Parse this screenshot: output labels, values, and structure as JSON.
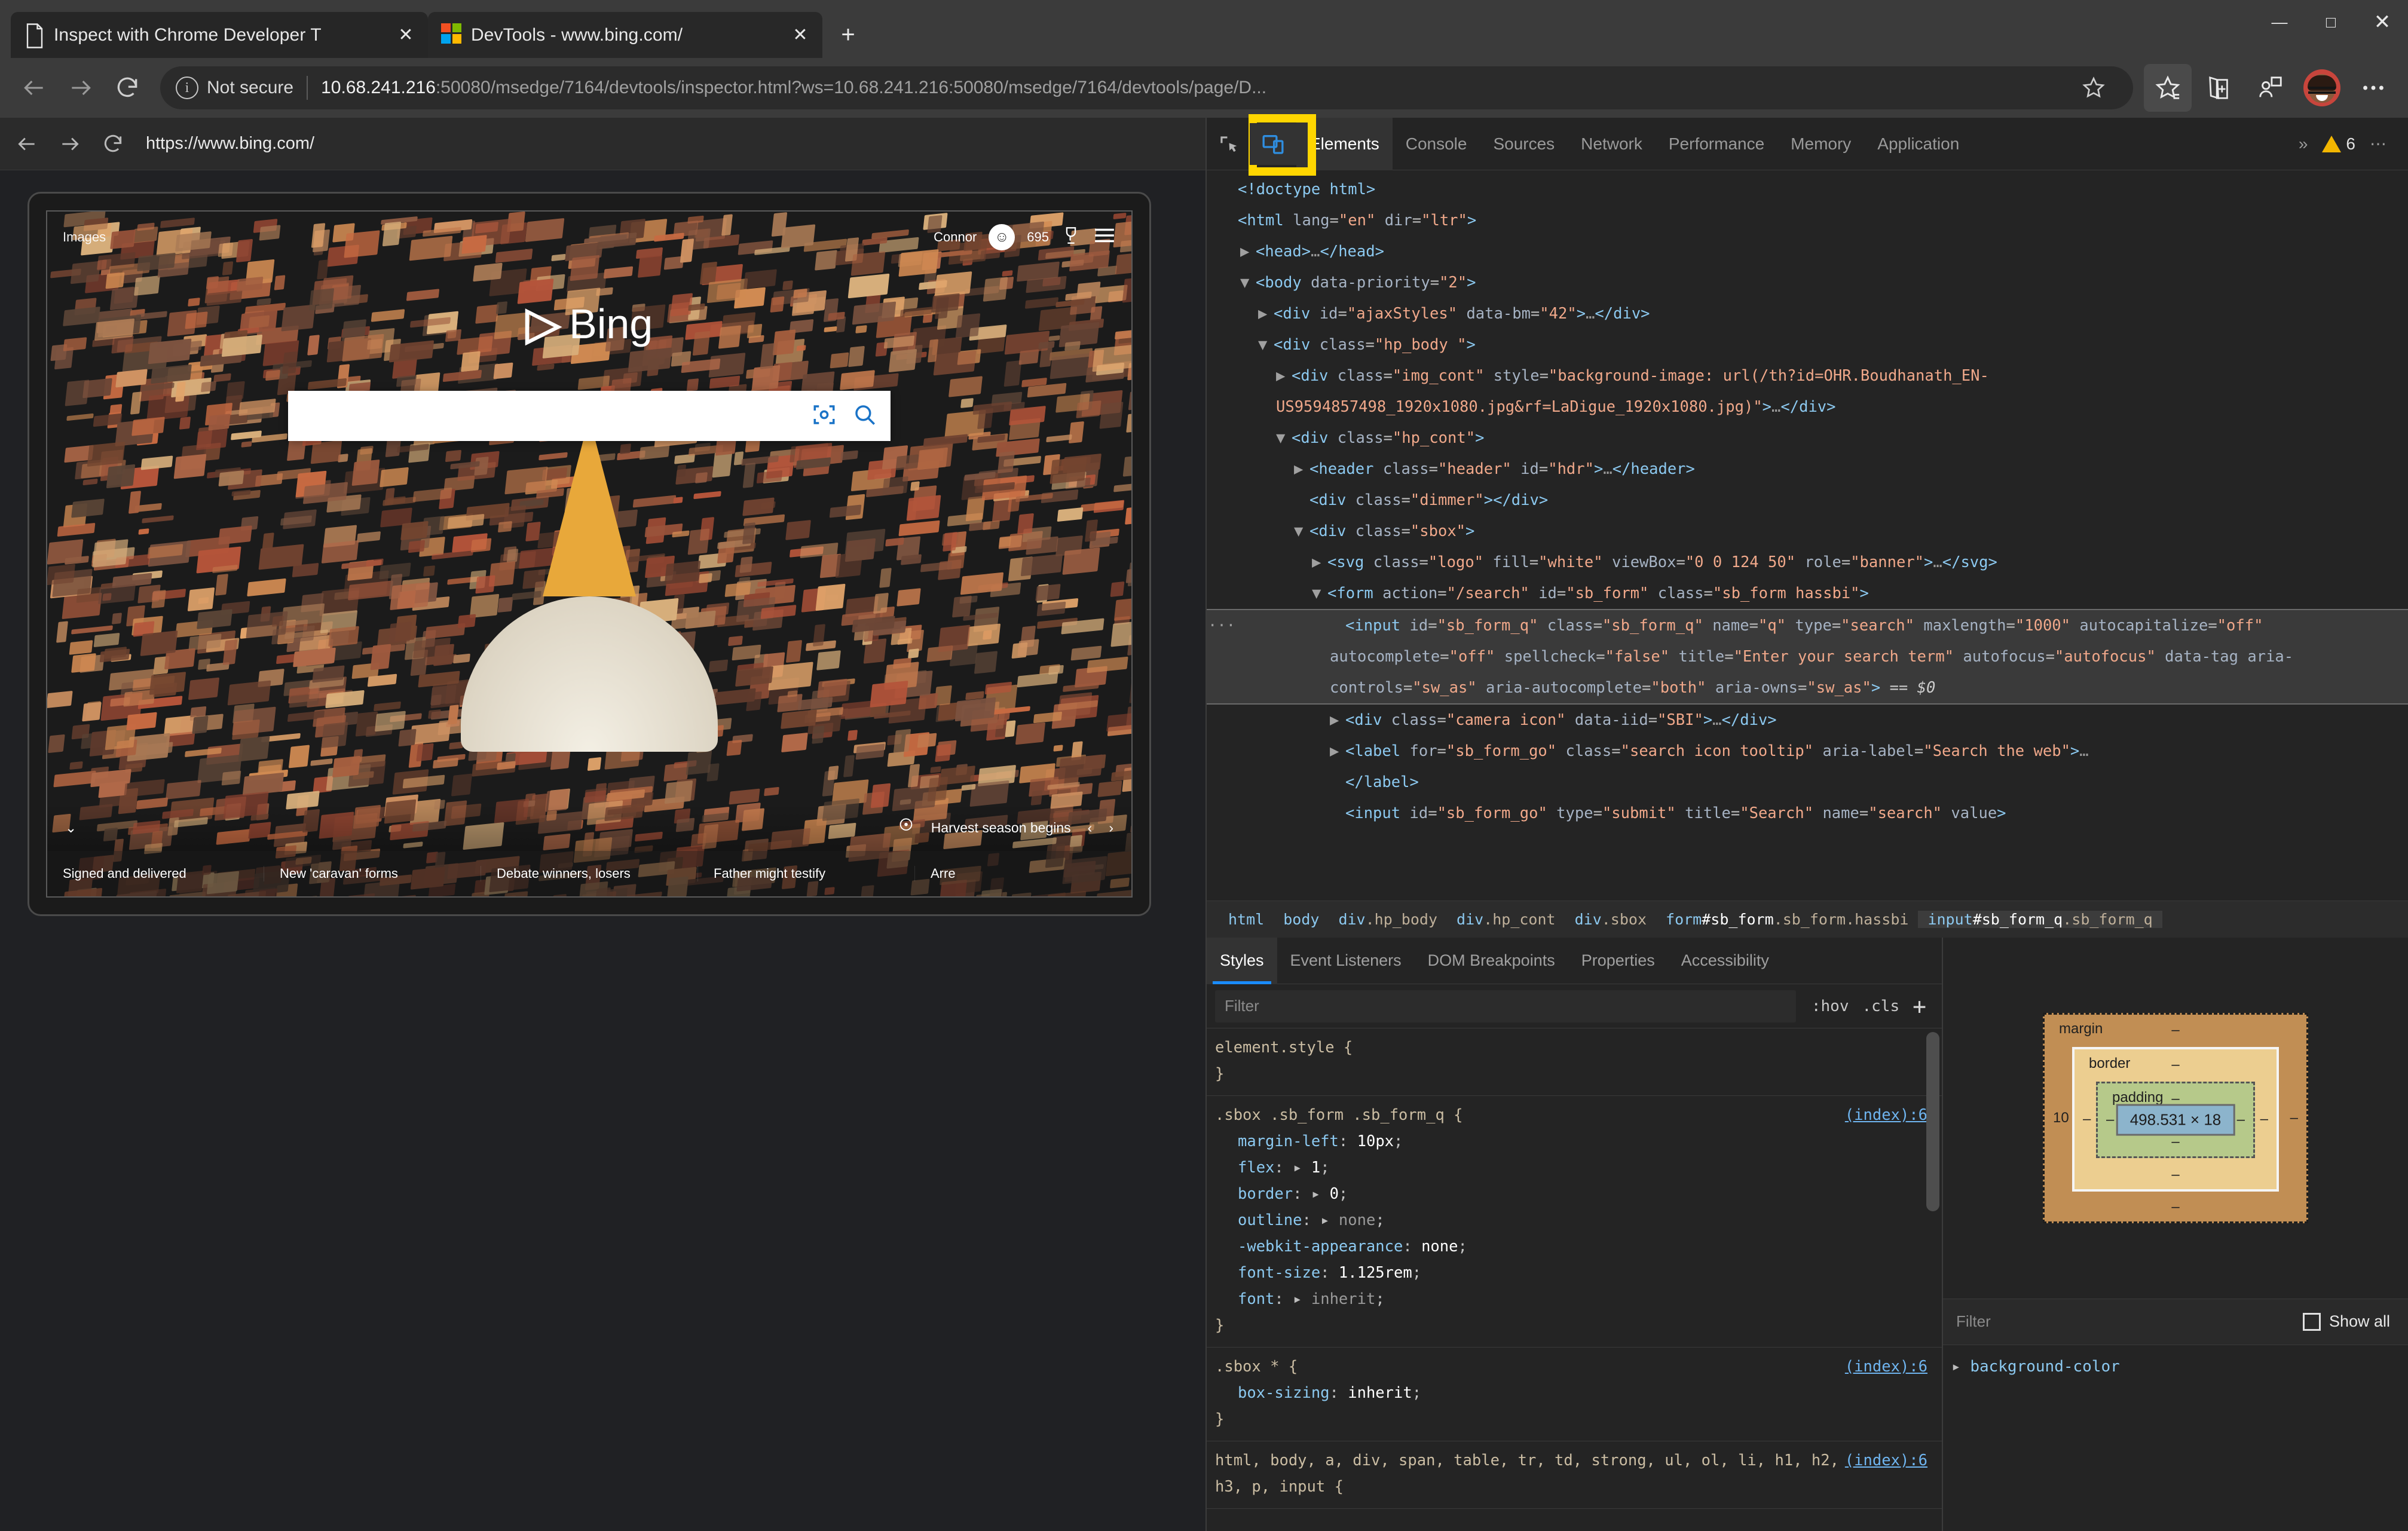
{
  "window": {
    "controls": {
      "minimize": "—",
      "maximize": "□",
      "close": "✕"
    }
  },
  "browser": {
    "tabs": [
      {
        "title": "Inspect with Chrome Developer T",
        "favicon": "document-icon",
        "active": false,
        "close": "✕"
      },
      {
        "title": "DevTools - www.bing.com/",
        "favicon": "microsoft-logo-icon",
        "active": true,
        "close": "✕"
      }
    ],
    "new_tab_label": "+",
    "nav": {
      "back": "←",
      "forward": "→",
      "reload": "↻"
    },
    "omnibox": {
      "security_label": "Not secure",
      "url_host": "10.68.241.216",
      "url_rest": ":50080/msedge/7164/devtools/inspector.html?ws=10.68.241.216:50080/msedge/7164/devtools/page/D...",
      "favorite_icon": "star-outline-icon"
    },
    "toolbar": [
      {
        "name": "favorites-icon",
        "glyph": "☆"
      },
      {
        "name": "collections-icon",
        "glyph": "☷"
      },
      {
        "name": "share-icon",
        "glyph": "⚇"
      },
      {
        "name": "profile-icon",
        "glyph": "☺"
      },
      {
        "name": "settings-more-icon",
        "glyph": "⋯"
      }
    ]
  },
  "page_pane": {
    "nav": {
      "back": "←",
      "forward": "→",
      "reload": "↻"
    },
    "url": "https://www.bing.com/",
    "bing": {
      "topbar_left": "Images",
      "account_name": "Connor",
      "rewards_points": "695",
      "rewards_icon": "trophy-icon",
      "menu_icon": "hamburger-icon",
      "logo_word": "Bing",
      "search_placeholder": "",
      "camera_icon": "visual-search-icon",
      "search_icon": "magnifier-icon",
      "caption": "Harvest season begins",
      "caption_pin_icon": "location-pin-icon",
      "caption_prev": "‹",
      "caption_next": "›",
      "collapse_icon": "⌄",
      "news": [
        "Signed and delivered",
        "New 'caravan' forms",
        "Debate winners, losers",
        "Father might testify",
        "Arre"
      ]
    }
  },
  "devtools": {
    "inspect_icon": "inspect-element-icon",
    "device_toolbar_icon": "device-toolbar-icon",
    "highlight_color": "#ffd600",
    "tabs": [
      {
        "label": "Elements",
        "active": true
      },
      {
        "label": "Console",
        "active": false
      },
      {
        "label": "Sources",
        "active": false
      },
      {
        "label": "Network",
        "active": false
      },
      {
        "label": "Performance",
        "active": false
      },
      {
        "label": "Memory",
        "active": false
      },
      {
        "label": "Application",
        "active": false
      }
    ],
    "more_tabs": "»",
    "warning_count": "6",
    "overflow_menu": "⋯",
    "dom_lines": [
      {
        "indent": 0,
        "tri": "",
        "html": "<span class=\"punc\">&lt;!doctype html&gt;</span>",
        "doctype_masked": true
      },
      {
        "indent": 0,
        "tri": "",
        "html": "<span class=\"tag\">&lt;html</span> <span class=\"attr\">lang</span>=<span class=\"val\">\"en\"</span> <span class=\"attr\">dir</span>=<span class=\"val\">\"ltr\"</span><span class=\"tag\">&gt;</span>"
      },
      {
        "indent": 1,
        "tri": "▶",
        "html": "<span class=\"tag\">&lt;head&gt;</span><span class=\"dim\">…</span><span class=\"tag\">&lt;/head&gt;</span>"
      },
      {
        "indent": 1,
        "tri": "▼",
        "html": "<span class=\"tag\">&lt;body</span> <span class=\"attr\">data-priority</span>=<span class=\"val\">\"2\"</span><span class=\"tag\">&gt;</span>"
      },
      {
        "indent": 2,
        "tri": "▶",
        "html": "<span class=\"tag\">&lt;div</span> <span class=\"attr\">id</span>=<span class=\"val\">\"ajaxStyles\"</span> <span class=\"attr\">data-bm</span>=<span class=\"val\">\"42\"</span><span class=\"tag\">&gt;</span><span class=\"dim\">…</span><span class=\"tag\">&lt;/div&gt;</span>"
      },
      {
        "indent": 2,
        "tri": "▼",
        "html": "<span class=\"tag\">&lt;div</span> <span class=\"attr\">class</span>=<span class=\"val\">\"hp_body \"</span><span class=\"tag\">&gt;</span>"
      },
      {
        "indent": 3,
        "tri": "▶",
        "html": "<span class=\"tag\">&lt;div</span> <span class=\"attr\">class</span>=<span class=\"val\">\"img_cont\"</span> <span class=\"attr\">style</span>=<span class=\"val\">\"background-image: url(/th?id=OHR.Boudhanath_EN-US9594857498_1920x1080.jpg&amp;rf=LaDigue_1920x1080.jpg)\"</span><span class=\"tag\">&gt;</span><span class=\"dim\">…</span><span class=\"tag\">&lt;/div&gt;</span>"
      },
      {
        "indent": 3,
        "tri": "▼",
        "html": "<span class=\"tag\">&lt;div</span> <span class=\"attr\">class</span>=<span class=\"val\">\"hp_cont\"</span><span class=\"tag\">&gt;</span>"
      },
      {
        "indent": 4,
        "tri": "▶",
        "html": "<span class=\"tag\">&lt;header</span> <span class=\"attr\">class</span>=<span class=\"val\">\"header\"</span> <span class=\"attr\">id</span>=<span class=\"val\">\"hdr\"</span><span class=\"tag\">&gt;</span><span class=\"dim\">…</span><span class=\"tag\">&lt;/header&gt;</span>"
      },
      {
        "indent": 4,
        "tri": "",
        "html": "<span class=\"tag\">&lt;div</span> <span class=\"attr\">class</span>=<span class=\"val\">\"dimmer\"</span><span class=\"tag\">&gt;&lt;/div&gt;</span>"
      },
      {
        "indent": 4,
        "tri": "▼",
        "html": "<span class=\"tag\">&lt;div</span> <span class=\"attr\">class</span>=<span class=\"val\">\"sbox\"</span><span class=\"tag\">&gt;</span>"
      },
      {
        "indent": 5,
        "tri": "▶",
        "html": "<span class=\"tag\">&lt;svg</span> <span class=\"attr\">class</span>=<span class=\"val\">\"logo\"</span> <span class=\"attr\">fill</span>=<span class=\"val\">\"white\"</span> <span class=\"attr\">viewBox</span>=<span class=\"val\">\"0 0 124 50\"</span> <span class=\"attr\">role</span>=<span class=\"val\">\"banner\"</span><span class=\"tag\">&gt;</span><span class=\"dim\">…</span><span class=\"tag\">&lt;/svg&gt;</span>"
      },
      {
        "indent": 5,
        "tri": "▼",
        "html": "<span class=\"tag\">&lt;form</span> <span class=\"attr\">action</span>=<span class=\"val\">\"/search\"</span> <span class=\"attr\">id</span>=<span class=\"val\">\"sb_form\"</span> <span class=\"attr\">class</span>=<span class=\"val\">\"sb_form hassbi\"</span><span class=\"tag\">&gt;</span>"
      },
      {
        "indent": 6,
        "tri": "",
        "selected": true,
        "html": "<span class=\"tag\">&lt;input</span> <span class=\"attr\">id</span>=<span class=\"val\">\"sb_form_q\"</span> <span class=\"attr\">class</span>=<span class=\"val\">\"sb_form_q\"</span> <span class=\"attr\">name</span>=<span class=\"val\">\"q\"</span> <span class=\"attr\">type</span>=<span class=\"val\">\"search\"</span> <span class=\"attr\">maxlength</span>=<span class=\"val\">\"1000\"</span> <span class=\"attr\">autocapitalize</span>=<span class=\"val\">\"off\"</span> <span class=\"attr\">autocomplete</span>=<span class=\"val\">\"off\"</span> <span class=\"attr\">spellcheck</span>=<span class=\"val\">\"false\"</span> <span class=\"attr\">title</span>=<span class=\"val\">\"Enter your search term\"</span> <span class=\"attr\">autofocus</span>=<span class=\"val\">\"autofocus\"</span> <span class=\"attr\">data-tag</span> <span class=\"attr\">aria-controls</span>=<span class=\"val\">\"sw_as\"</span> <span class=\"attr\">aria-autocomplete</span>=<span class=\"val\">\"both\"</span> <span class=\"attr\">aria-owns</span>=<span class=\"val\">\"sw_as\"</span><span class=\"tag\">&gt;</span> <span class=\"eq\">== $0</span>"
      },
      {
        "indent": 6,
        "tri": "▶",
        "html": "<span class=\"tag\">&lt;div</span> <span class=\"attr\">class</span>=<span class=\"val\">\"camera icon\"</span> <span class=\"attr\">data-iid</span>=<span class=\"val\">\"SBI\"</span><span class=\"tag\">&gt;</span><span class=\"dim\">…</span><span class=\"tag\">&lt;/div&gt;</span>"
      },
      {
        "indent": 6,
        "tri": "▶",
        "html": "<span class=\"tag\">&lt;label</span> <span class=\"attr\">for</span>=<span class=\"val\">\"sb_form_go\"</span> <span class=\"attr\">class</span>=<span class=\"val\">\"search icon tooltip\"</span> <span class=\"attr\">aria-label</span>=<span class=\"val\">\"Search the web\"</span><span class=\"tag\">&gt;</span><span class=\"dim\">…</span>"
      },
      {
        "indent": 6,
        "tri": "",
        "html": "<span class=\"tag\">&lt;/label&gt;</span>"
      },
      {
        "indent": 6,
        "tri": "",
        "html": "<span class=\"tag\">&lt;input</span> <span class=\"attr\">id</span>=<span class=\"val\">\"sb_form_go\"</span> <span class=\"attr\">type</span>=<span class=\"val\">\"submit\"</span> <span class=\"attr\">title</span>=<span class=\"val\">\"Search\"</span> <span class=\"attr\">name</span>=<span class=\"val\">\"search\"</span> <span class=\"attr\">value</span><span class=\"tag\">&gt;</span>"
      }
    ],
    "breadcrumbs": [
      {
        "tag": "html",
        "id": "",
        "cls": "",
        "active": false
      },
      {
        "tag": "body",
        "id": "",
        "cls": "",
        "active": false
      },
      {
        "tag": "div",
        "id": "",
        "cls": ".hp_body",
        "active": false
      },
      {
        "tag": "div",
        "id": "",
        "cls": ".hp_cont",
        "active": false
      },
      {
        "tag": "div",
        "id": "",
        "cls": ".sbox",
        "active": false
      },
      {
        "tag": "form",
        "id": "#sb_form",
        "cls": ".sb_form.hassbi",
        "active": false
      },
      {
        "tag": "input",
        "id": "#sb_form_q",
        "cls": ".sb_form_q",
        "active": true
      }
    ],
    "styles": {
      "tabs": [
        {
          "label": "Styles",
          "active": true
        },
        {
          "label": "Event Listeners",
          "active": false
        },
        {
          "label": "DOM Breakpoints",
          "active": false
        },
        {
          "label": "Properties",
          "active": false
        },
        {
          "label": "Accessibility",
          "active": false
        }
      ],
      "filter_placeholder": "Filter",
      "hov_label": ":hov",
      "cls_label": ".cls",
      "new_rule_label": "+",
      "rules": [
        {
          "selector": "element.style {",
          "source": "",
          "decls": [],
          "close": "}"
        },
        {
          "selector": ".sbox .sb_form .sb_form_q {",
          "source": "(index):6",
          "decls": [
            {
              "prop": "margin-left",
              "value": "10px",
              "expand": false,
              "dim": false
            },
            {
              "prop": "flex",
              "value": "1",
              "expand": true,
              "dim": false
            },
            {
              "prop": "border",
              "value": "0",
              "expand": true,
              "dim": false
            },
            {
              "prop": "outline",
              "value": "none",
              "expand": true,
              "dim": true
            },
            {
              "prop": "-webkit-appearance",
              "value": "none",
              "expand": false,
              "dim": false
            },
            {
              "prop": "font-size",
              "value": "1.125rem",
              "expand": false,
              "dim": false
            },
            {
              "prop": "font",
              "value": "inherit",
              "expand": true,
              "dim": true
            }
          ],
          "close": "}"
        },
        {
          "selector": ".sbox * {",
          "source": "(index):6",
          "decls": [
            {
              "prop": "box-sizing",
              "value": "inherit",
              "expand": false,
              "dim": false
            }
          ],
          "close": "}"
        },
        {
          "selector": "html, body, a, div, span, table, tr, td, strong, ul, ol, li, h1, h2, h3, p, input {",
          "source": "(index):6",
          "decls": [],
          "close": ""
        }
      ]
    },
    "box_model": {
      "margin_label": "margin",
      "border_label": "border",
      "padding_label": "padding",
      "content_size": "498.531 × 18",
      "margin_top": "–",
      "margin_right": "–",
      "margin_bottom": "–",
      "margin_left": "10",
      "border_top": "–",
      "border_right": "–",
      "border_bottom": "–",
      "border_left": "–",
      "padding_top": "–",
      "padding_right": "–",
      "padding_bottom": "–",
      "padding_left": "–"
    },
    "computed": {
      "filter_placeholder": "Filter",
      "show_all_label": "Show all",
      "show_all_checked": false,
      "properties": [
        "background-color"
      ]
    }
  }
}
